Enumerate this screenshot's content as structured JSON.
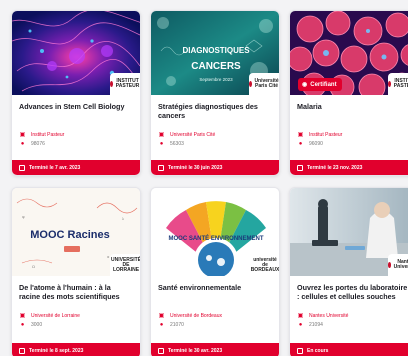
{
  "cards": [
    {
      "title": "Advances in Stem Cell Biology",
      "org": "Institut Pasteur",
      "number": "98076",
      "status": "Terminé le 7 avr. 2023",
      "logo": "INSTITUT PASTEUR",
      "certified": false,
      "thumb_icon": "stem-cell-image"
    },
    {
      "title": "Stratégies diagnostiques des cancers",
      "org": "Université Paris Cité",
      "number": "56303",
      "status": "Terminé le 30 juin 2023",
      "logo": "Université Paris Cité",
      "thumb_texts": [
        "DIAGNOSTIQUES",
        "CANCERS",
        "Septembre 2023"
      ],
      "certified": false,
      "thumb_icon": "cancer-diagnostics-image"
    },
    {
      "title": "Malaria",
      "org": "Institut Pasteur",
      "number": "96090",
      "status": "Terminé le 23 nov. 2023",
      "logo": "INSTITUT PASTEUR",
      "certified": true,
      "certified_label": "Certifiant",
      "thumb_icon": "malaria-cells-image"
    },
    {
      "title": "De l'atome à l'humain : à la racine des mots scientifiques",
      "org": "Université de Lorraine",
      "number": "3000",
      "status": "Terminé le 8 sept. 2023",
      "logo": "UNIVERSITÉ DE LORRAINE",
      "thumb_texts": [
        "MOOC Racines"
      ],
      "certified": false,
      "thumb_icon": "mooc-racines-image"
    },
    {
      "title": "Santé environnementale",
      "org": "Université de Bordeaux",
      "number": "21070",
      "status": "Terminé le 30 avr. 2023",
      "logo": "université de BORDEAUX",
      "thumb_texts": [
        "MOOC SANTÉ ENVIRONNEMENT"
      ],
      "certified": false,
      "thumb_icon": "sante-environnement-image"
    },
    {
      "title": "Ouvrez les portes du laboratoire : cellules et cellules souches",
      "org": "Nantes Université",
      "number": "21094",
      "status": "En cours",
      "logo": "Nantes Université",
      "certified": false,
      "thumb_icon": "laboratory-image"
    }
  ],
  "colors": {
    "accent": "#e1002d",
    "title": "#1c1c24",
    "muted": "#777777"
  }
}
